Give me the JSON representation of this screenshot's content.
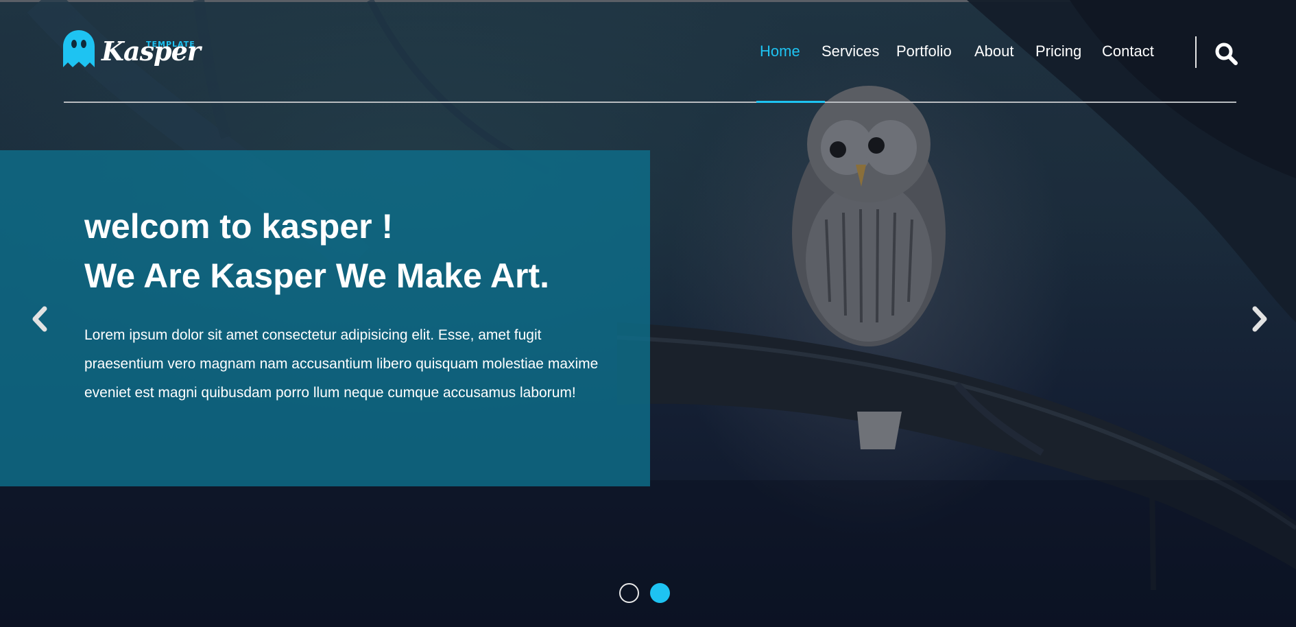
{
  "brand": {
    "tag": "TEMPLATE",
    "name": "Kasper",
    "logo_icon": "ghost-icon",
    "accent_color": "#1ec3f2"
  },
  "nav": {
    "items": [
      {
        "label": "Home",
        "active": true
      },
      {
        "label": "Services",
        "active": false
      },
      {
        "label": "Portfolio",
        "active": false
      },
      {
        "label": "About",
        "active": false
      },
      {
        "label": "Pricing",
        "active": false
      },
      {
        "label": "Contact",
        "active": false
      }
    ],
    "search_icon": "search-icon"
  },
  "slide": {
    "title": "welcom to kasper !",
    "subtitle": "We Are Kasper We Make Art.",
    "text": "Lorem ipsum dolor sit amet consectetur adipisicing elit. Esse, amet fugit praesentium vero magnam nam accusantium libero quisquam molestiae maxime eveniet est magni quibusdam porro llum neque cumque accusamus laborum!",
    "caption_color": "#0e6e8a"
  },
  "carousel": {
    "prev_icon": "chevron-left-icon",
    "next_icon": "chevron-right-icon",
    "slides_count": 2,
    "active_slide": 2
  }
}
